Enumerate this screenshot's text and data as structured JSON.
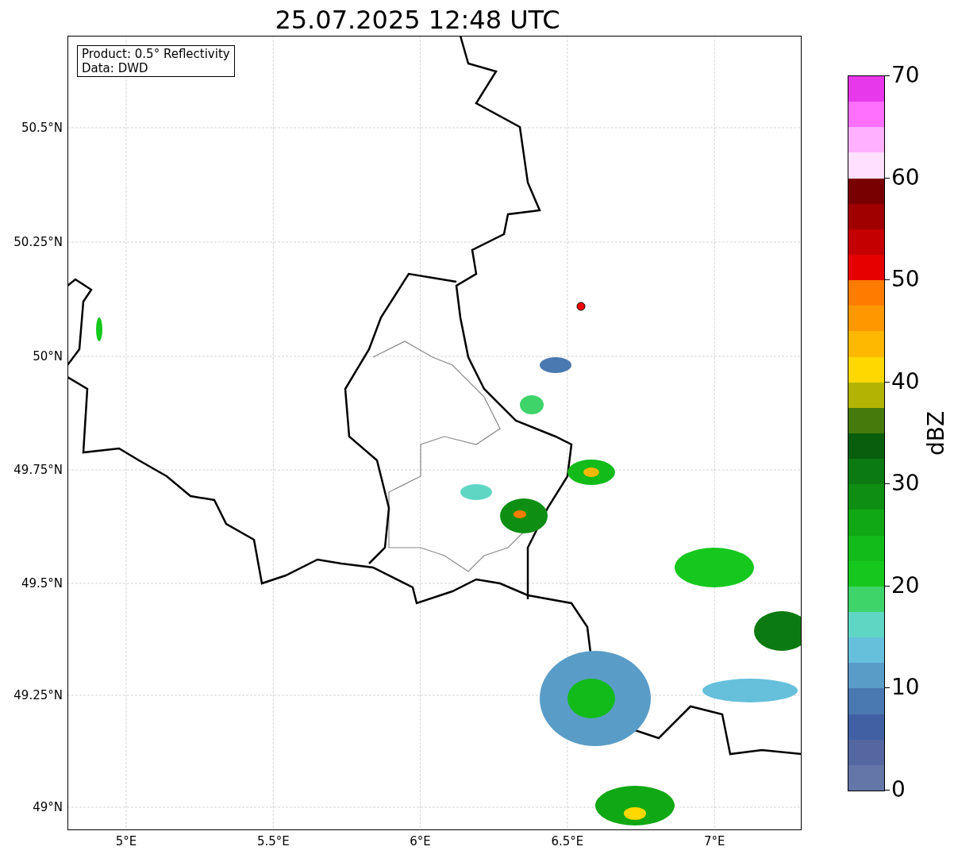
{
  "title": "25.07.2025 12:48 UTC",
  "map": {
    "info_box": [
      "Product: 0.5° Reflectivity",
      "Data: DWD"
    ],
    "lat_ticks": [
      "50.5°N",
      "50.25°N",
      "50°N",
      "49.75°N",
      "49.5°N",
      "49.25°N",
      "49°N"
    ],
    "lon_ticks": [
      "5°E",
      "5.5°E",
      "6°E",
      "6.5°E",
      "7°E"
    ]
  },
  "colorbar": {
    "label": "dBZ",
    "ticks": [
      "70",
      "60",
      "50",
      "40",
      "30",
      "20",
      "10",
      "0"
    ],
    "bins": [
      {
        "color": "#6475a8"
      },
      {
        "color": "#5567a0"
      },
      {
        "color": "#4160a4"
      },
      {
        "color": "#4a78b0"
      },
      {
        "color": "#5a9cc8"
      },
      {
        "color": "#66c0dc"
      },
      {
        "color": "#5fd6c4"
      },
      {
        "color": "#3ed46a"
      },
      {
        "color": "#16c81e"
      },
      {
        "color": "#12bb1a"
      },
      {
        "color": "#10a814"
      },
      {
        "color": "#0e8f14"
      },
      {
        "color": "#0b7a12"
      },
      {
        "color": "#085e0c"
      },
      {
        "color": "#467a0c"
      },
      {
        "color": "#b2b404"
      },
      {
        "color": "#ffd800"
      },
      {
        "color": "#ffb800"
      },
      {
        "color": "#ff9800"
      },
      {
        "color": "#ff7c00"
      },
      {
        "color": "#e60000"
      },
      {
        "color": "#c40000"
      },
      {
        "color": "#a00000"
      },
      {
        "color": "#780000"
      },
      {
        "color": "#ffe0ff"
      },
      {
        "color": "#ffb0ff"
      },
      {
        "color": "#ff70ff"
      },
      {
        "color": "#e838ec"
      }
    ]
  }
}
